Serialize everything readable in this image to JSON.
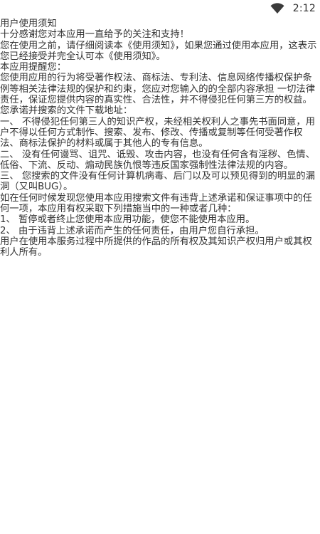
{
  "status_bar": {
    "time": "2:12",
    "wifi_icon": "wifi-icon"
  },
  "notice": {
    "title": "用户使用须知",
    "paragraphs": [
      "十分感谢您对本应用一直给予的关注和支持！",
      "您在使用之前，请仔细阅读本《使用须知》，如果您通过使用本应用，这表示您已经接受并完全认可本《使用须知》。",
      "本应用提醒您：",
      "您使用应用的行为将受著作权法、商标法、专利法、信息网络传播权保护条例等相关法律法规的保护和约束，您应对您输入的的全部内容承担 一切法律责任，保证您提供内容的真实性、合法性，并不得侵犯任何第三方的权益。",
      "您承诺并搜索的文件下载地址：",
      "一、 不得侵犯任何第三人的知识产权，未经相关权利人之事先书面同意，用户不得以任何方式制作、搜索、发布、修改、传播或复制等任何受著作权法、商标法保护的材料或属于其他人的专有信息。",
      "二、 没有任何谩骂、诅咒、诋毁、攻击内容，也没有任何含有淫秽、色情、低俗、下流、反动、煽动民族仇恨等违反国家强制性法律法规的内容。",
      "三、 您搜索的文件没有任何计算机病毒、后门以及可以预见得到的明显的漏洞（又叫BUG）。",
      "如在任何时候发现您使用本应用搜索文件有违背上述承诺和保证事项中的任何一项，本应用有权采取下列措施当中的一种或者几种：",
      "1、 暂停或者终止您使用本应用功能，使您不能使用本应用。",
      "2、 由于违背上述承诺而产生的任何责任，由用户您自行承担。",
      "用户在使用本服务过程中所提供的作品的所有权及其知识产权归用户或其权利人所有。"
    ]
  }
}
